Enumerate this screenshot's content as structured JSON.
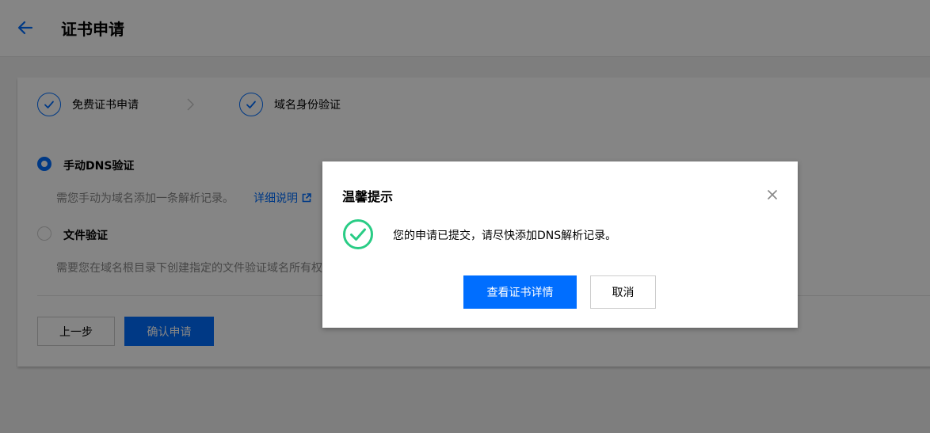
{
  "header": {
    "title": "证书申请"
  },
  "steps": [
    {
      "label": "免费证书申请"
    },
    {
      "label": "域名身份验证"
    }
  ],
  "options": [
    {
      "title": "手动DNS验证",
      "desc": "需您手动为域名添加一条解析记录。",
      "link": "详细说明",
      "selected": true
    },
    {
      "title": "文件验证",
      "desc": "需要您在域名根目录下创建指定的文件验证域名所有权",
      "selected": false
    }
  ],
  "footer": {
    "prev_label": "上一步",
    "confirm_label": "确认申请"
  },
  "dialog": {
    "title": "温馨提示",
    "message": "您的申请已提交，请尽快添加DNS解析记录。",
    "primary_label": "查看证书详情",
    "cancel_label": "取消"
  },
  "colors": {
    "accent": "#006eff",
    "success": "#29cc85"
  }
}
